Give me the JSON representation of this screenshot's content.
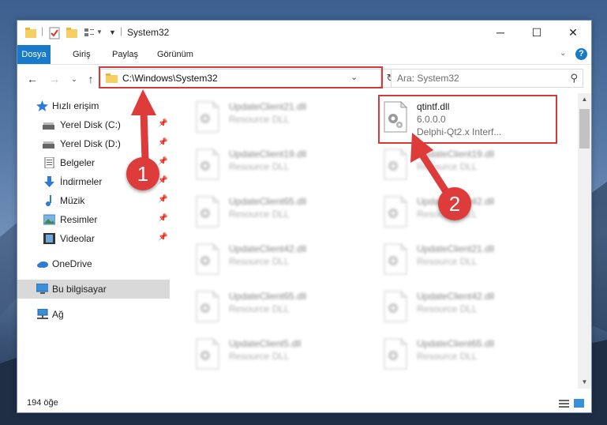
{
  "window": {
    "title": "System32"
  },
  "ribbon": {
    "tabs": [
      {
        "label": "Dosya"
      },
      {
        "label": "Giriş"
      },
      {
        "label": "Paylaş"
      },
      {
        "label": "Görünüm"
      }
    ]
  },
  "address": {
    "path": "C:\\Windows\\System32"
  },
  "search": {
    "placeholder": "Ara: System32"
  },
  "sidebar": {
    "items": [
      {
        "label": "Hızlı erişim"
      },
      {
        "label": "Yerel Disk (C:)"
      },
      {
        "label": "Yerel Disk (D:)"
      },
      {
        "label": "Belgeler"
      },
      {
        "label": "İndirmeler"
      },
      {
        "label": "Müzik"
      },
      {
        "label": "Resimler"
      },
      {
        "label": "Videolar"
      },
      {
        "label": "OneDrive"
      },
      {
        "label": "Bu bilgisayar"
      },
      {
        "label": "Ağ"
      }
    ]
  },
  "files": {
    "highlighted": {
      "name": "qtintf.dll",
      "version": "6.0.0.0",
      "description": "Delphi-Qt2.x Interf..."
    },
    "left": [
      {
        "name": "UpdateClient21.dll",
        "type": "Resource DLL"
      },
      {
        "name": "UpdateClient19.dll",
        "type": "Resource DLL"
      },
      {
        "name": "UpdateClient65.dll",
        "type": "Resource DLL"
      },
      {
        "name": "UpdateClient42.dll",
        "type": "Resource DLL"
      },
      {
        "name": "UpdateClient65.dll",
        "type": "Resource DLL"
      },
      {
        "name": "UpdateClient5.dll",
        "type": "Resource DLL"
      }
    ],
    "right": [
      {
        "name": "UpdateClient19.dll",
        "type": "Resource DLL"
      },
      {
        "name": "UpdateClient42.dll",
        "type": "Resource DLL"
      },
      {
        "name": "UpdateClient21.dll",
        "type": "Resource DLL"
      },
      {
        "name": "UpdateClient42.dll",
        "type": "Resource DLL"
      },
      {
        "name": "UpdateClient65.dll",
        "type": "Resource DLL"
      }
    ]
  },
  "status": {
    "count": "194 öğe"
  },
  "annotations": {
    "step1": "1",
    "step2": "2"
  },
  "colors": {
    "accent": "#1979ca",
    "highlight": "#d33b3b"
  }
}
